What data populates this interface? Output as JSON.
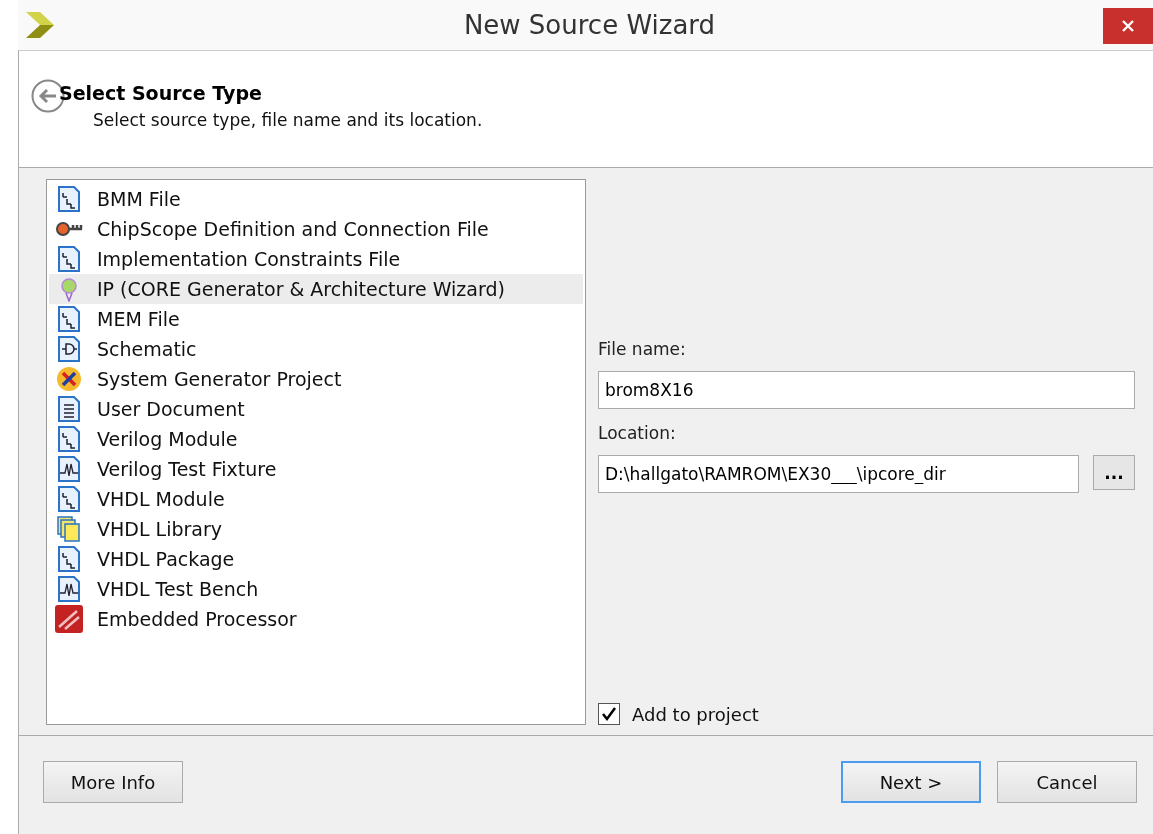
{
  "window": {
    "title": "New Source Wizard"
  },
  "header": {
    "title": "Select Source Type",
    "subtitle": "Select source type, file name and its location."
  },
  "source_types": [
    {
      "label": "BMM File",
      "kind": "file",
      "selected": false
    },
    {
      "label": "ChipScope Definition and Connection File",
      "kind": "probe",
      "selected": false
    },
    {
      "label": "Implementation Constraints File",
      "kind": "file",
      "selected": false
    },
    {
      "label": "IP (CORE Generator & Architecture Wizard)",
      "kind": "bulb",
      "selected": true
    },
    {
      "label": "MEM File",
      "kind": "file",
      "selected": false
    },
    {
      "label": "Schematic",
      "kind": "gate",
      "selected": false
    },
    {
      "label": "System Generator Project",
      "kind": "sysgen",
      "selected": false
    },
    {
      "label": "User Document",
      "kind": "text",
      "selected": false
    },
    {
      "label": "Verilog Module",
      "kind": "file",
      "selected": false
    },
    {
      "label": "Verilog Test Fixture",
      "kind": "wave",
      "selected": false
    },
    {
      "label": "VHDL Module",
      "kind": "file",
      "selected": false
    },
    {
      "label": "VHDL Library",
      "kind": "library",
      "selected": false
    },
    {
      "label": "VHDL Package",
      "kind": "file",
      "selected": false
    },
    {
      "label": "VHDL Test Bench",
      "kind": "wave",
      "selected": false
    },
    {
      "label": "Embedded Processor",
      "kind": "processor",
      "selected": false
    }
  ],
  "file_name": {
    "label": "File name:",
    "value": "brom8X16"
  },
  "location": {
    "label": "Location:",
    "value": "D:\\hallgato\\RAMROM\\EX30___\\ipcore_dir",
    "browse": "..."
  },
  "add_to_project": {
    "label": "Add to project",
    "checked": true
  },
  "buttons": {
    "more_info": "More Info",
    "next": "Next >",
    "cancel": "Cancel"
  }
}
